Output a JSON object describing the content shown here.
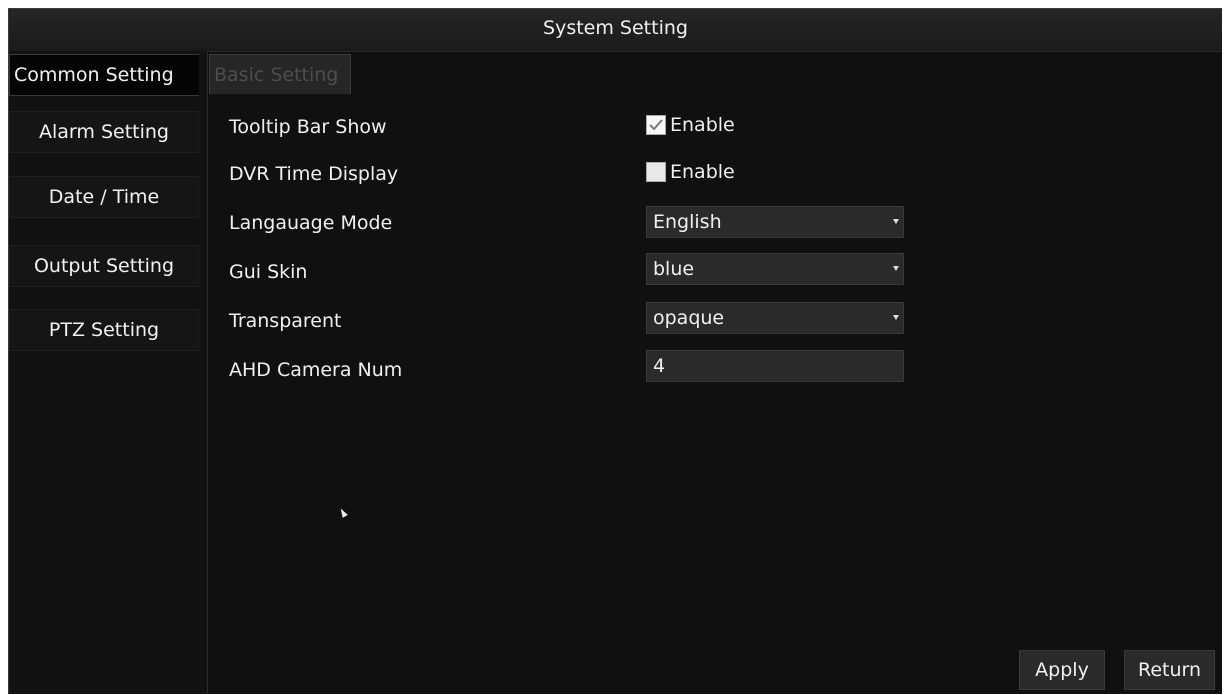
{
  "window": {
    "title": "System Setting"
  },
  "sidebar": {
    "items": [
      {
        "label": "Common Setting",
        "active": true
      },
      {
        "label": "Alarm Setting"
      },
      {
        "label": "Date / Time"
      },
      {
        "label": "Output Setting"
      },
      {
        "label": "PTZ Setting"
      }
    ]
  },
  "tabs": [
    {
      "label": "Basic Setting"
    }
  ],
  "settings": {
    "tooltip_bar_show": {
      "label": "Tooltip Bar Show",
      "checkbox_label": "Enable",
      "checked": true,
      "check_icon": "checkmark-icon"
    },
    "dvr_time_display": {
      "label": "DVR Time Display",
      "checkbox_label": "Enable",
      "checked": false
    },
    "language_mode": {
      "label": "Langauage Mode",
      "value": "English"
    },
    "gui_skin": {
      "label": "Gui Skin",
      "value": "blue"
    },
    "transparent": {
      "label": "Transparent",
      "value": "opaque"
    },
    "ahd_camera_num": {
      "label": "AHD Camera Num",
      "value": "4"
    }
  },
  "buttons": {
    "apply": "Apply",
    "return": "Return"
  }
}
